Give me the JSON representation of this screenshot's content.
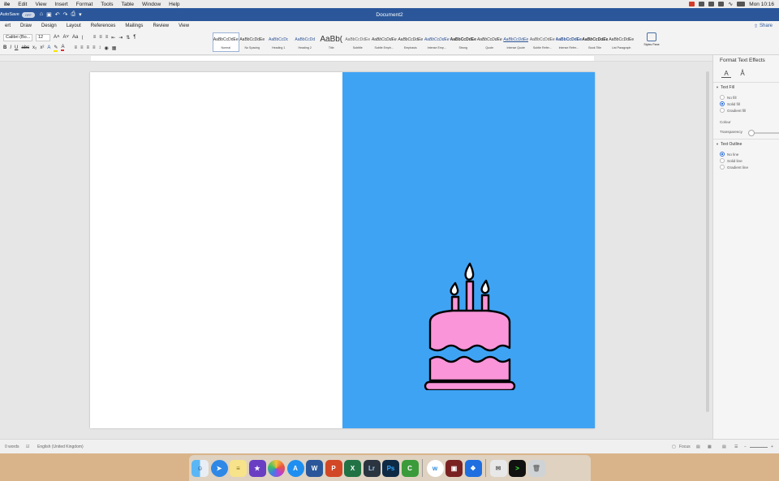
{
  "menubar": {
    "items": [
      "ile",
      "Edit",
      "View",
      "Insert",
      "Format",
      "Tools",
      "Table",
      "Window",
      "Help"
    ],
    "clock": "Mon 10:16"
  },
  "titlebar": {
    "autosave_label": "AutoSave",
    "autosave_state": "OFF",
    "document_title": "Document2"
  },
  "tabs": [
    "ert",
    "Draw",
    "Design",
    "Layout",
    "References",
    "Mailings",
    "Review",
    "View"
  ],
  "share_label": "Share",
  "ribbon": {
    "font_name": "Calibri (Bo...",
    "font_size": "12",
    "change_case": "Aa",
    "styles": [
      {
        "preview": "AaBbCcDdEe",
        "name": "Normal"
      },
      {
        "preview": "AaBbCcDdEe",
        "name": "No Spacing"
      },
      {
        "preview": "AaBbCcDc",
        "name": "Heading 1"
      },
      {
        "preview": "AaBbCcDd",
        "name": "Heading 2"
      },
      {
        "preview": "AaBb(",
        "name": "Title"
      },
      {
        "preview": "AaBbCcDdEe",
        "name": "Subtitle"
      },
      {
        "preview": "AaBbCcDdEe",
        "name": "Subtle Emph..."
      },
      {
        "preview": "AaBbCcDdEe",
        "name": "Emphasis"
      },
      {
        "preview": "AaBbCcDdEe",
        "name": "Intense Emp..."
      },
      {
        "preview": "AaBbCcDdEe",
        "name": "Strong"
      },
      {
        "preview": "AaBbCcDdEe",
        "name": "Quote"
      },
      {
        "preview": "AaBbCcDdEe",
        "name": "Intense Quote"
      },
      {
        "preview": "AaBbCcDdEe",
        "name": "Subtle Refer..."
      },
      {
        "preview": "AaBbCcDdEe",
        "name": "Intense Refer..."
      },
      {
        "preview": "AaBbCcDdEe",
        "name": "Book Title"
      },
      {
        "preview": "AaBbCcDdEe",
        "name": "List Paragraph"
      }
    ],
    "styles_pane_label": "Styles Pane"
  },
  "format_pane": {
    "title": "Format Text Effects",
    "text_fill_header": "Text Fill",
    "fill_options": [
      "No fill",
      "Solid fill",
      "Gradient fill"
    ],
    "fill_selected": 1,
    "colour_label": "Colour",
    "transparency_label": "Transparency",
    "text_outline_header": "Text Outline",
    "outline_options": [
      "No line",
      "Solid line",
      "Gradient line"
    ],
    "outline_selected": 0
  },
  "status": {
    "word_count": "0 words",
    "language": "English (United Kingdom)",
    "focus_label": "Focus"
  },
  "colors": {
    "blue_panel": "#3fa3f4",
    "cake_pink": "#f995d8",
    "word_blue": "#2b579a"
  },
  "dock": {
    "apps": [
      "finder-icon",
      "safari-icon",
      "notes-icon",
      "imovie-icon",
      "photos-icon",
      "app-store-icon",
      "word-icon",
      "powerpoint-icon",
      "excel-icon",
      "lightroom-icon",
      "photoshop-icon",
      "camtasia-icon",
      "wunderlist-icon",
      "photo-booth-icon",
      "dropbox-icon",
      "mail-doc-icon",
      "terminal-icon",
      "trash-icon"
    ]
  }
}
